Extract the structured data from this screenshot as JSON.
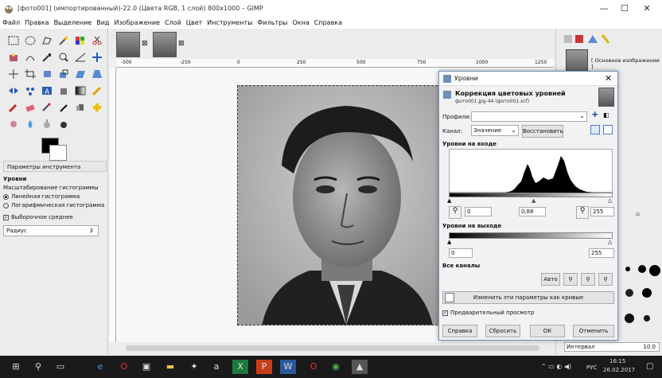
{
  "window": {
    "title": "[фото001] (импортированный)-22.0 (Цвета RGB, 1 слой) 800x1000 – GIMP",
    "min": "—",
    "max": "☐",
    "close": "✕"
  },
  "menu": [
    "Файл",
    "Правка",
    "Выделение",
    "Вид",
    "Изображение",
    "Слой",
    "Цвет",
    "Инструменты",
    "Фильтры",
    "Окна",
    "Справка"
  ],
  "tool_options": {
    "header": "Параметры инструмента",
    "title": "Уровни",
    "histogram_scale_label": "Масштабирование гистограммы",
    "linear": "Линейная гистограмма",
    "log": "Логарифмическая гистограмма",
    "sample_merged": "Выборочное среднее",
    "radius_label": "Радиус",
    "radius_value": "3"
  },
  "ruler_ticks": [
    "-500",
    "-250",
    "0",
    "250",
    "500",
    "750",
    "1000",
    "1250"
  ],
  "dialog": {
    "title": "Уровни",
    "heading": "Коррекция цветовых уровней",
    "subtitle": "фото001.jpg-44 (фото001.xcf)",
    "presets_label": "Профили:",
    "channel_label": "Канал:",
    "channel_value": "Значение",
    "reset_channel": "Восстановить",
    "input_levels": "Уровни на входе",
    "input_low": "0",
    "input_gamma": "0,88",
    "input_high": "255",
    "output_levels": "Уровни на выходе",
    "output_low": "0",
    "output_high": "255",
    "all_channels": "Все каналы",
    "auto": "Авто",
    "edit_curves": "Изменить эти параметры как кривые",
    "preview": "Предварительный просмотр",
    "help": "Справка",
    "reset": "Сбросить",
    "ok": "ОК",
    "cancel": "Отменить"
  },
  "right_dock": {
    "layer_name": "[ Основное изображение ]",
    "spacing_label": "Интервал",
    "spacing_value": "10.0"
  },
  "taskbar": {
    "time": "16:15",
    "date": "26.02.2017",
    "lang": "РУС"
  }
}
